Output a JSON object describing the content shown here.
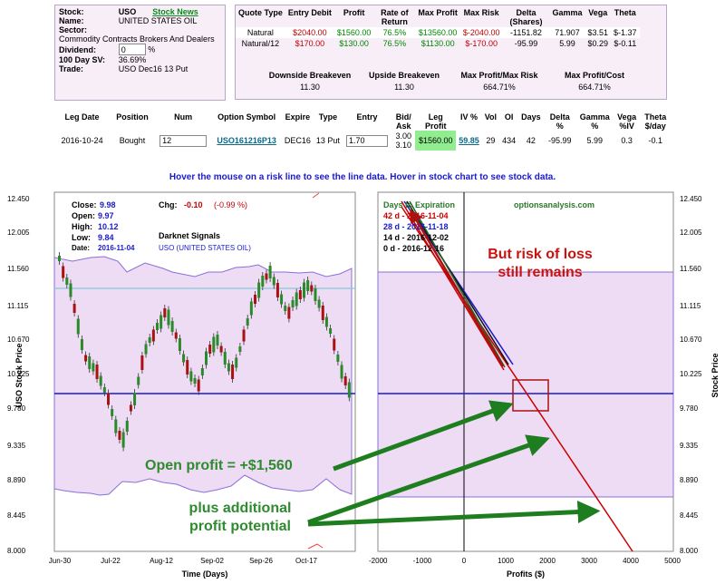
{
  "stock_info": {
    "stock_label": "Stock:",
    "symbol": "USO",
    "stock_news_link": "Stock News",
    "name_label": "Name:",
    "name_value": "UNITED STATES OIL",
    "sector_label": "Sector:",
    "sector_value": "Commodity Contracts Brokers And Dealers",
    "dividend_label": "Dividend:",
    "dividend_value": "0",
    "dividend_unit": "%",
    "sv_label": "100 Day SV:",
    "sv_value": "36.69%",
    "trade_label": "Trade:",
    "trade_value": "USO Dec16 13 Put"
  },
  "quote_table": {
    "headers": [
      "Quote Type",
      "Entry Debit",
      "Profit",
      "Rate of Return",
      "Max Profit",
      "Max Risk",
      "Delta (Shares)",
      "Gamma",
      "Vega",
      "Theta"
    ],
    "rows": [
      [
        "Natural",
        "$2040.00",
        "$1560.00",
        "76.5%",
        "$13560.00",
        "$-2040.00",
        "-1151.82",
        "71.907",
        "$3.51",
        "$-1.37"
      ],
      [
        "Natural/12",
        "$170.00",
        "$130.00",
        "76.5%",
        "$1130.00",
        "$-170.00",
        "-95.99",
        "5.99",
        "$0.29",
        "$-0.11"
      ]
    ],
    "sub_headers": [
      "Downside Breakeven",
      "Upside Breakeven",
      "Max Profit/Max Risk",
      "Max Profit/Cost"
    ],
    "sub_values": [
      "11.30",
      "11.30",
      "664.71%",
      "664.71%"
    ]
  },
  "leg_table": {
    "headers": [
      "Leg Date",
      "Position",
      "Num",
      "Option Symbol",
      "Expire",
      "Type",
      "Entry",
      "Bid/ Ask",
      "Leg Profit",
      "IV %",
      "Vol",
      "OI",
      "Days",
      "Delta %",
      "Gamma %",
      "Vega %IV",
      "Theta $/day"
    ],
    "leg_date": "2016-10-24",
    "position": "Bought",
    "num": "12",
    "option_symbol": "USO161216P13",
    "expire": "DEC16",
    "type": "13 Put",
    "entry": "1.70",
    "bid": "3.00",
    "ask": "3.10",
    "leg_profit": "$1560.00",
    "iv": "59.85",
    "vol": "29",
    "oi": "434",
    "days": "42",
    "delta": "-95.99",
    "gamma": "5.99",
    "vega": "0.3",
    "theta": "-0.1"
  },
  "hint_text": "Hover the mouse on a risk line to see the line data. Hover in stock chart to see stock data.",
  "stock_chart": {
    "close_label": "Close:",
    "close_value": "9.98",
    "open_label": "Open:",
    "open_value": "9.97",
    "high_label": "High:",
    "high_value": "10.12",
    "low_label": "Low:",
    "low_value": "9.84",
    "date_label": "Date:",
    "date_value": "2016-11-04",
    "chg_label": "Chg:",
    "chg_value": "-0.10",
    "chg_pct": "(-0.99 %)",
    "signals_title": "Darknet Signals",
    "signals_sub": "USO (UNITED STATES OIL)",
    "ylabel": "USO Stock Price",
    "xlabel": "Time (Days)",
    "x_ticks": [
      "Jun-30",
      "Jul-22",
      "Aug-12",
      "Sep-02",
      "Sep-26",
      "Oct-17"
    ]
  },
  "risk_chart": {
    "title_label": "Days to Expiration",
    "site_label": "optionsanalysis.com",
    "lines": [
      {
        "label": "42 d - 2016-11-04",
        "color": "#cc0000"
      },
      {
        "label": "28 d - 2016-11-18",
        "color": "#1a1acc"
      },
      {
        "label": "14 d - 2016-12-02",
        "color": "#000000"
      },
      {
        "label": "0 d - 2016-12-16",
        "color": "#000000"
      }
    ],
    "ylabel": "Stock Price",
    "xlabel": "Profits ($)",
    "x_ticks": [
      "-2000",
      "-1000",
      "0",
      "1000",
      "2000",
      "3000",
      "4000",
      "5000"
    ],
    "y_ticks": [
      "12.450",
      "12.005",
      "11.560",
      "11.115",
      "10.670",
      "10.225",
      "9.780",
      "9.335",
      "8.890",
      "8.445",
      "8.000"
    ]
  },
  "annotations": {
    "risk_line1": "But risk of loss",
    "risk_line2": "still remains",
    "open_profit": "Open profit = +$1,560",
    "potential_line1": "plus additional",
    "potential_line2": "profit potential"
  },
  "colors": {
    "panel_bg": "#f7eef7",
    "chart_bg": "#ffffff",
    "band_fill": "#e8d8f0",
    "price_line": "#1a1acc",
    "arrow_green": "#1e7d1e",
    "annot_red": "#cc1111",
    "annot_green": "#2e8b2e"
  }
}
